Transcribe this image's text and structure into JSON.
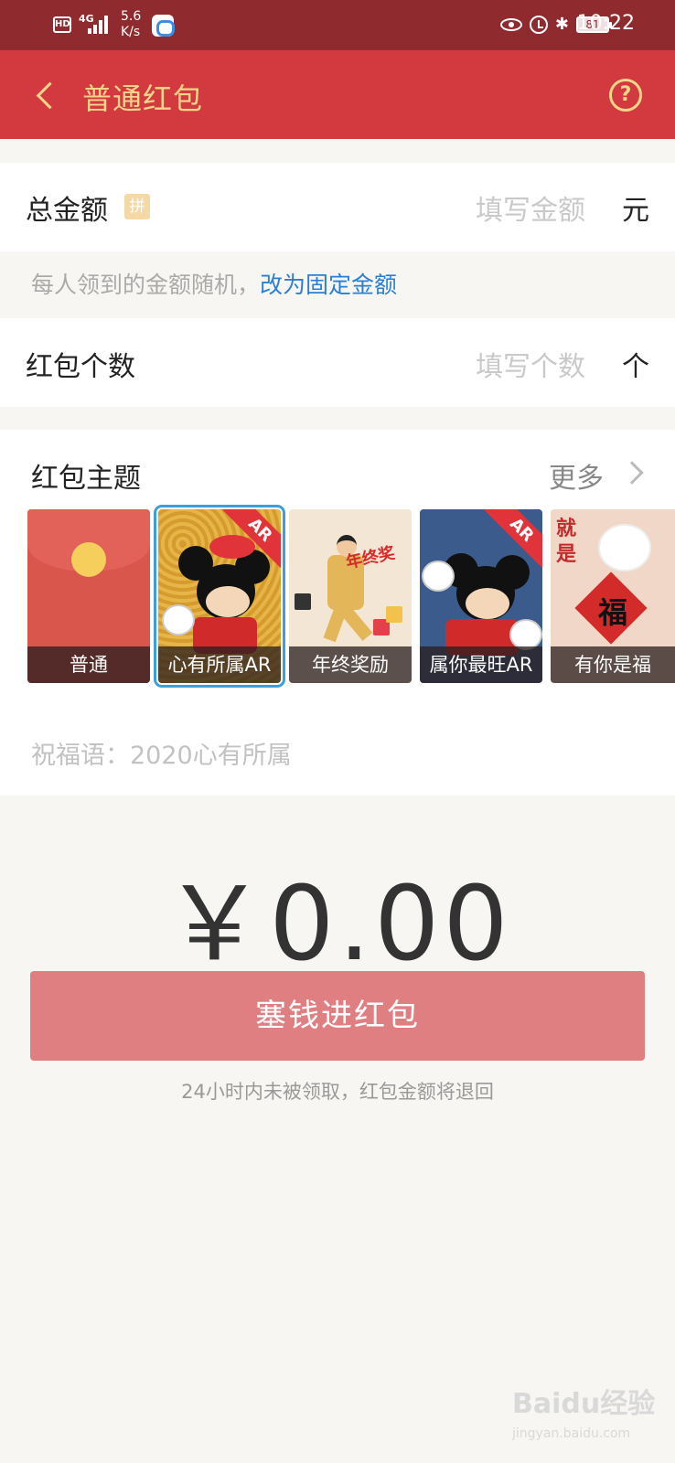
{
  "status_bar": {
    "hd": "HD",
    "network": "4G",
    "speed": "5.6\nK/s",
    "battery": "81",
    "time": "10:22"
  },
  "nav": {
    "title": "普通红包"
  },
  "total": {
    "label": "总金额",
    "badge": "拼",
    "placeholder": "填写金额",
    "unit": "元"
  },
  "hint": {
    "text": "每人领到的金额随机，",
    "link": "改为固定金额"
  },
  "count": {
    "label": "红包个数",
    "placeholder": "填写个数",
    "unit": "个"
  },
  "themes": {
    "title": "红包主题",
    "more": "更多",
    "cards": [
      {
        "label": "普通",
        "selected": false
      },
      {
        "label": "心有所属AR",
        "selected": true,
        "ar": "AR"
      },
      {
        "label": "年终奖励",
        "selected": false,
        "art_text": "年终奖"
      },
      {
        "label": "属你最旺AR",
        "selected": false,
        "ar": "AR"
      },
      {
        "label": "有你是福",
        "selected": false,
        "art_text": "就是",
        "art_char": "福"
      }
    ]
  },
  "blessing": {
    "text": "祝福语：2020心有所属"
  },
  "amount": "￥0.00",
  "submit": "塞钱进红包",
  "footnote": "24小时内未被领取，红包金额将退回",
  "watermark": {
    "logo": "Baidu经验",
    "url": "jingyan.baidu.com"
  },
  "colors": {
    "status_bar": "#8f2a2e",
    "nav_bar": "#d33a3f",
    "nav_text": "#f4d58a",
    "link": "#2a7fd4",
    "submit_button": "#e07f82"
  }
}
